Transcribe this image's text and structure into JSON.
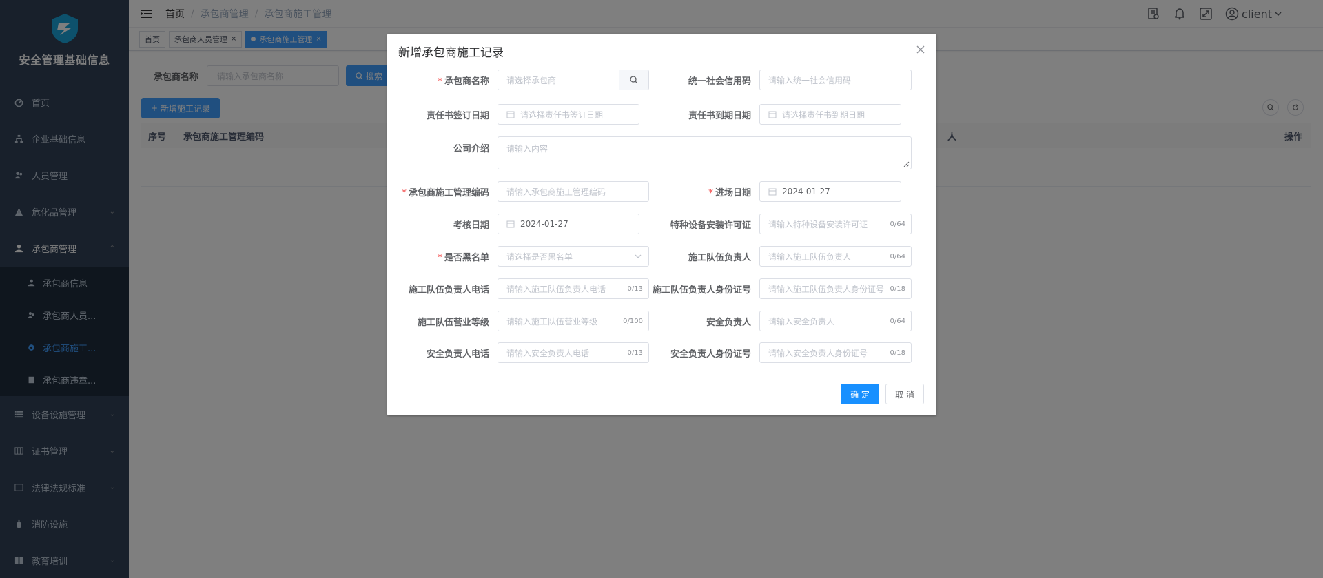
{
  "sidebar": {
    "title": "安全管理基础信息",
    "items": [
      {
        "label": "首页",
        "icon": "dashboard-icon"
      },
      {
        "label": "企业基础信息",
        "icon": "org-tree-icon"
      },
      {
        "label": "人员管理",
        "icon": "people-icon"
      },
      {
        "label": "危化品管理",
        "icon": "warning-icon"
      },
      {
        "label": "承包商管理",
        "icon": "user-icon"
      }
    ],
    "sub_items": [
      {
        "label": "承包商信息"
      },
      {
        "label": "承包商人员..."
      },
      {
        "label": "承包商施工..."
      },
      {
        "label": "承包商违章..."
      }
    ],
    "items_after": [
      {
        "label": "设备设施管理"
      },
      {
        "label": "证书管理"
      },
      {
        "label": "法律法规标准"
      },
      {
        "label": "消防设施"
      },
      {
        "label": "教育培训"
      }
    ]
  },
  "navbar": {
    "breadcrumb": [
      "首页",
      "承包商管理",
      "承包商施工管理"
    ],
    "user": "client"
  },
  "tags": [
    "首页",
    "承包商人员管理",
    "承包商施工管理"
  ],
  "main": {
    "search_label": "承包商名称",
    "search_placeholder": "请输入承包商名称",
    "search_btn": "搜索",
    "add_btn": "新增施工记录",
    "columns": [
      "序号",
      "承包商施工管理编码",
      "人",
      "操作"
    ]
  },
  "dialog": {
    "title": "新增承包商施工记录",
    "fields": {
      "contractor_name": {
        "label": "承包商名称",
        "placeholder": "请选择承包商"
      },
      "credit_code": {
        "label": "统一社会信用码",
        "placeholder": "请输入统一社会信用码"
      },
      "sign_date": {
        "label": "责任书签订日期",
        "placeholder": "请选择责任书签订日期"
      },
      "expire_date": {
        "label": "责任书到期日期",
        "placeholder": "请选择责任书到期日期"
      },
      "company_intro": {
        "label": "公司介绍",
        "placeholder": "请输入内容"
      },
      "mgmt_code": {
        "label": "承包商施工管理编码",
        "placeholder": "请输入承包商施工管理编码"
      },
      "entry_date": {
        "label": "进场日期",
        "value": "2024-01-27"
      },
      "assess_date": {
        "label": "考核日期",
        "value": "2024-01-27"
      },
      "special_license": {
        "label": "特种设备安装许可证",
        "placeholder": "请输入特种设备安装许可证",
        "count": "0/64"
      },
      "blacklist": {
        "label": "是否黑名单",
        "placeholder": "请选择是否黑名单"
      },
      "team_leader": {
        "label": "施工队伍负责人",
        "placeholder": "请输入施工队伍负责人",
        "count": "0/64"
      },
      "team_leader_phone": {
        "label": "施工队伍负责人电话",
        "placeholder": "请输入施工队伍负责人电话",
        "count": "0/13"
      },
      "team_leader_id": {
        "label": "施工队伍负责人身份证号",
        "placeholder": "请输入施工队伍负责人身份证号",
        "count": "0/18"
      },
      "team_grade": {
        "label": "施工队伍营业等级",
        "placeholder": "请输入施工队伍营业等级",
        "count": "0/100"
      },
      "safety_leader": {
        "label": "安全负责人",
        "placeholder": "请输入安全负责人",
        "count": "0/64"
      },
      "safety_phone": {
        "label": "安全负责人电话",
        "placeholder": "请输入安全负责人电话",
        "count": "0/13"
      },
      "safety_id": {
        "label": "安全负责人身份证号",
        "placeholder": "请输入安全负责人身份证号",
        "count": "0/18"
      }
    },
    "ok": "确 定",
    "cancel": "取 消"
  },
  "colors": {
    "primary": "#409eff",
    "sidebar_bg": "#304156",
    "danger": "#f56c6c"
  }
}
